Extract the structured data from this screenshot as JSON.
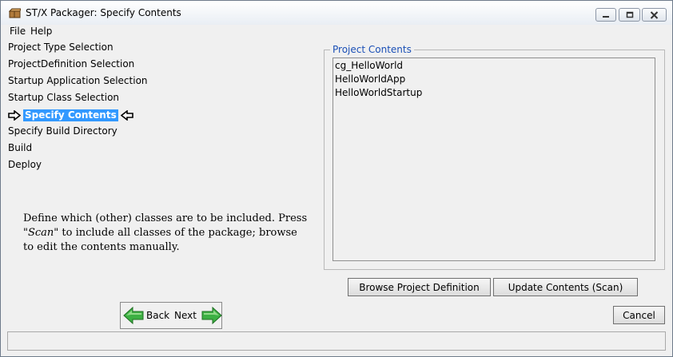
{
  "window": {
    "title": "ST/X Packager: Specify Contents"
  },
  "menu": {
    "items": [
      "File",
      "Help"
    ]
  },
  "steps": [
    {
      "label": "Project Type Selection"
    },
    {
      "label": "ProjectDefinition Selection"
    },
    {
      "label": "Startup Application Selection"
    },
    {
      "label": "Startup Class Selection"
    },
    {
      "label": "Specify Contents",
      "current": true
    },
    {
      "label": "Specify Build Directory"
    },
    {
      "label": "Build"
    },
    {
      "label": "Deploy"
    }
  ],
  "description": {
    "part1": "Define which (other) classes are to be included. Press \"",
    "emphasis": "Scan",
    "part2": "\" to include all classes of the package; browse to edit the contents manually."
  },
  "project_contents": {
    "title": "Project Contents",
    "items": [
      "cg_HelloWorld",
      "HelloWorldApp",
      "HelloWorldStartup"
    ]
  },
  "buttons": {
    "browse": "Browse Project Definition",
    "update": "Update Contents (Scan)",
    "back": "Back",
    "next": "Next",
    "cancel": "Cancel"
  },
  "colors": {
    "selection": "#3399ff",
    "group_title": "#1a4fb6",
    "arrow_green": "#3cb043"
  }
}
